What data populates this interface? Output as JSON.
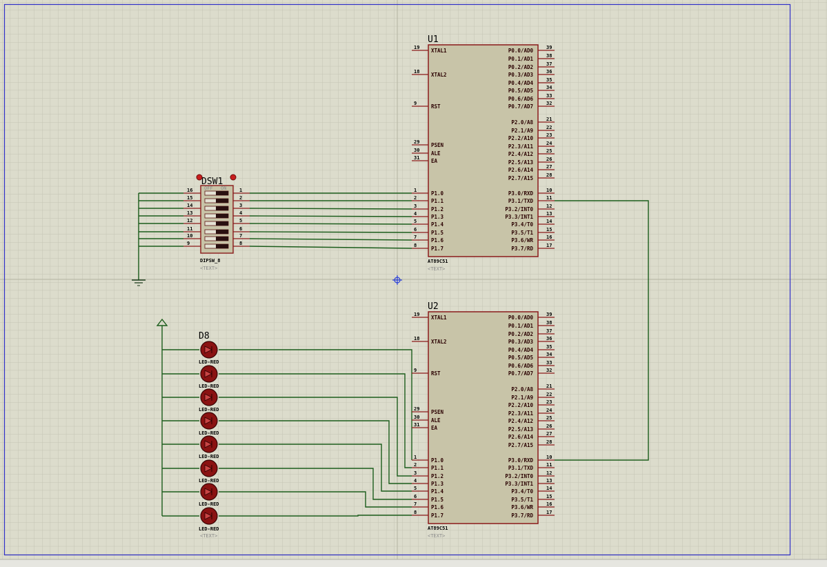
{
  "colors": {
    "background": "#dcdccc",
    "grid": "#c4c4b3",
    "border": "#3030c8",
    "body_fill": "#c8c4a8",
    "body_stroke": "#8a1a1a",
    "pin": "#8a1a1a",
    "wire": "#1b5c1b",
    "led": "#8a1212"
  },
  "mcu_pins": {
    "left_top": [
      {
        "name": "XTAL1",
        "num": "19"
      },
      {
        "name": "XTAL2",
        "num": "18"
      },
      {
        "name": "RST",
        "num": "9"
      },
      {
        "name": "PSEN",
        "num": "29"
      },
      {
        "name": "ALE",
        "num": "30"
      },
      {
        "name": "EA",
        "num": "31"
      }
    ],
    "port1": [
      {
        "name": "P1.0",
        "num": "1"
      },
      {
        "name": "P1.1",
        "num": "2"
      },
      {
        "name": "P1.2",
        "num": "3"
      },
      {
        "name": "P1.3",
        "num": "4"
      },
      {
        "name": "P1.4",
        "num": "5"
      },
      {
        "name": "P1.5",
        "num": "6"
      },
      {
        "name": "P1.6",
        "num": "7"
      },
      {
        "name": "P1.7",
        "num": "8"
      }
    ],
    "port0": [
      {
        "name": "P0.0/AD0",
        "num": "39"
      },
      {
        "name": "P0.1/AD1",
        "num": "38"
      },
      {
        "name": "P0.2/AD2",
        "num": "37"
      },
      {
        "name": "P0.3/AD3",
        "num": "36"
      },
      {
        "name": "P0.4/AD4",
        "num": "35"
      },
      {
        "name": "P0.5/AD5",
        "num": "34"
      },
      {
        "name": "P0.6/AD6",
        "num": "33"
      },
      {
        "name": "P0.7/AD7",
        "num": "32"
      }
    ],
    "port2": [
      {
        "name": "P2.0/A8",
        "num": "21"
      },
      {
        "name": "P2.1/A9",
        "num": "22"
      },
      {
        "name": "P2.2/A10",
        "num": "23"
      },
      {
        "name": "P2.3/A11",
        "num": "24"
      },
      {
        "name": "P2.4/A12",
        "num": "25"
      },
      {
        "name": "P2.5/A13",
        "num": "26"
      },
      {
        "name": "P2.6/A14",
        "num": "27"
      },
      {
        "name": "P2.7/A15",
        "num": "28"
      }
    ],
    "port3": [
      {
        "name": "P3.0/RXD",
        "num": "10"
      },
      {
        "name": "P3.1/TXD",
        "num": "11"
      },
      {
        "name": "P3.2/INT0",
        "num": "12"
      },
      {
        "name": "P3.3/INT1",
        "num": "13"
      },
      {
        "name": "P3.4/T0",
        "num": "14"
      },
      {
        "name": "P3.5/T1",
        "num": "15"
      },
      {
        "name": "P3.6/WR",
        "num": "16"
      },
      {
        "name": "P3.7/RD",
        "num": "17"
      }
    ]
  },
  "u1": {
    "ref": "U1",
    "part": "AT89C51",
    "text": "<TEXT>"
  },
  "u2": {
    "ref": "U2",
    "part": "AT89C51",
    "text": "<TEXT>"
  },
  "dsw1": {
    "ref": "DSW1",
    "part": "DIPSW_8",
    "text": "<TEXT>",
    "off_label": "OFF",
    "on_label": "ON",
    "left_pins": [
      "16",
      "15",
      "14",
      "13",
      "12",
      "11",
      "10",
      "9"
    ],
    "right_pins": [
      "1",
      "2",
      "3",
      "4",
      "5",
      "6",
      "7",
      "8"
    ]
  },
  "led": {
    "first_ref": "D8",
    "part": "LED-RED",
    "text": "<TEXT>"
  }
}
